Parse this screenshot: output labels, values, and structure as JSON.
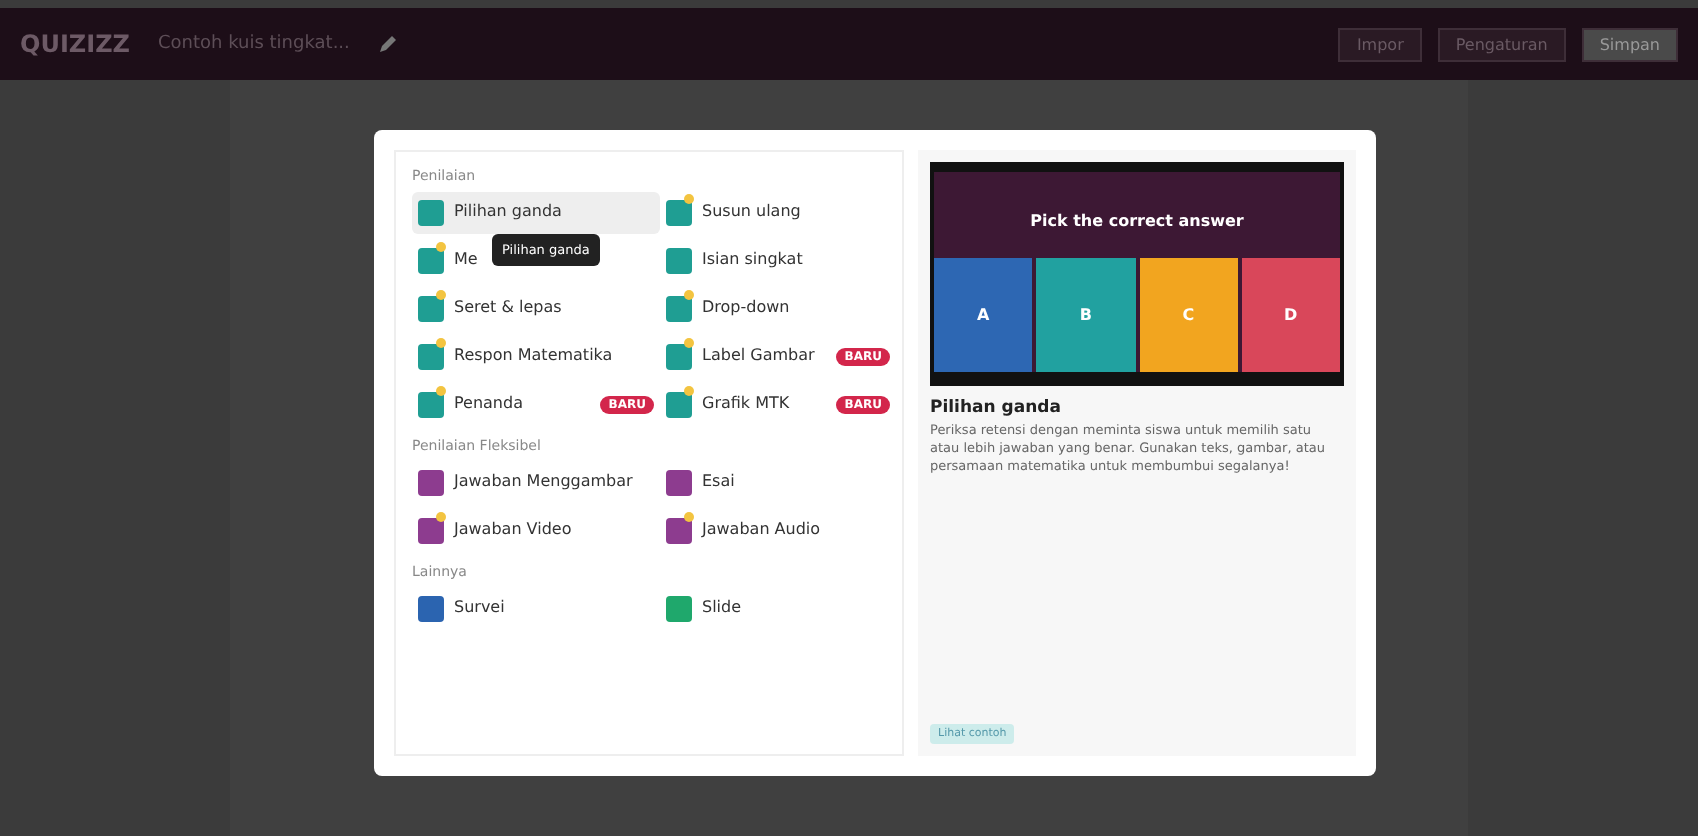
{
  "top_bar": {
    "logo": "QUIZIZZ",
    "title": "Contoh kuis tingkat...",
    "buttons": [
      "Impor",
      "Pengaturan",
      "Simpan"
    ]
  },
  "modal": {
    "sections": [
      {
        "title": "Penilaian",
        "items": [
          {
            "label": "Pilihan ganda",
            "color": "#1f9e93",
            "premium": false,
            "selected": true
          },
          {
            "label": "Susun ulang",
            "color": "#1f9e93",
            "premium": true,
            "selected": false
          },
          {
            "label": "Me",
            "color": "#1f9e93",
            "premium": true,
            "selected": false
          },
          {
            "label": "Isian singkat",
            "color": "#1f9e93",
            "premium": false,
            "selected": false
          },
          {
            "label": "Seret & lepas",
            "color": "#1f9e93",
            "premium": true,
            "selected": false
          },
          {
            "label": "Drop-down",
            "color": "#1f9e93",
            "premium": true,
            "selected": false
          },
          {
            "label": "Respon Matematika",
            "color": "#1f9e93",
            "premium": true,
            "selected": false
          },
          {
            "label": "Label Gambar",
            "color": "#1f9e93",
            "premium": true,
            "selected": false,
            "badge": "BARU"
          },
          {
            "label": "Penanda",
            "color": "#1f9e93",
            "premium": true,
            "selected": false,
            "badge": "BARU"
          },
          {
            "label": "Grafik MTK",
            "color": "#1f9e93",
            "premium": true,
            "selected": false,
            "badge": "BARU"
          }
        ]
      },
      {
        "title": "Penilaian Fleksibel",
        "items": [
          {
            "label": "Jawaban Menggambar",
            "color": "#8d3c8f",
            "premium": false,
            "selected": false
          },
          {
            "label": "Esai",
            "color": "#8d3c8f",
            "premium": false,
            "selected": false
          },
          {
            "label": "Jawaban Video",
            "color": "#8d3c8f",
            "premium": true,
            "selected": false
          },
          {
            "label": "Jawaban Audio",
            "color": "#8d3c8f",
            "premium": true,
            "selected": false
          }
        ]
      },
      {
        "title": "Lainnya",
        "items": [
          {
            "label": "Survei",
            "color": "#2b64b0",
            "premium": false,
            "selected": false
          },
          {
            "label": "Slide",
            "color": "#1fa86c",
            "premium": false,
            "selected": false
          }
        ]
      }
    ],
    "tooltip": "Pilihan ganda",
    "preview": {
      "question": "Pick the correct answer",
      "options": [
        {
          "label": "A",
          "color": "#2d67b3"
        },
        {
          "label": "B",
          "color": "#21a1a0"
        },
        {
          "label": "C",
          "color": "#f2a51f"
        },
        {
          "label": "D",
          "color": "#d9475a"
        }
      ],
      "title": "Pilihan ganda",
      "description": "Periksa retensi dengan meminta siswa untuk memilih satu atau lebih jawaban yang benar. Gunakan teks, gambar, atau persamaan matematika untuk membumbui segalanya!",
      "link": "Lihat contoh"
    }
  }
}
